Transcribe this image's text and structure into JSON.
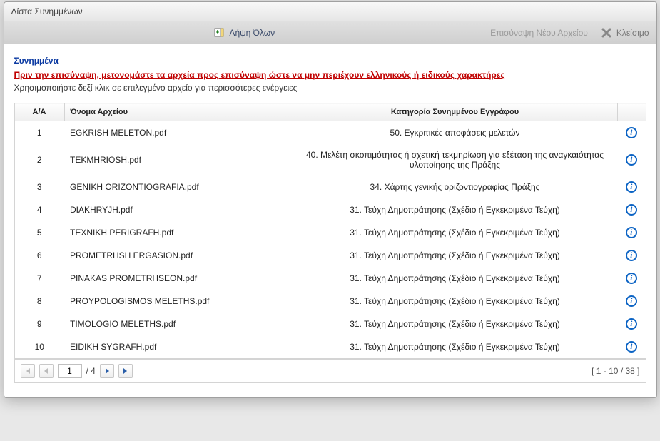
{
  "dialog": {
    "title": "Λίστα Συνημμένων"
  },
  "toolbar": {
    "download_all": "Λήψη Όλων",
    "attach_new": "Επισύναψη Νέου Αρχείου",
    "close": "Κλείσιμο"
  },
  "section": {
    "title": "Συνημμένα",
    "warning": "Πριν την επισύναψη, μετονομάστε τα αρχεία προς επισύναψη ώστε να μην περιέχουν ελληνικούς ή ειδικούς χαρακτήρες",
    "hint": "Χρησιμοποιήστε δεξί κλικ σε επιλεγμένο αρχείο για περισσότερες ενέργειες"
  },
  "columns": {
    "aa": "A/A",
    "filename": "Όνομα Αρχείου",
    "category": "Κατηγορία Συνημμένου Εγγράφου",
    "info": ""
  },
  "rows": [
    {
      "aa": "1",
      "file": "EGKRISH MELETON.pdf",
      "cat": "50. Εγκριτικές αποφάσεις μελετών"
    },
    {
      "aa": "2",
      "file": "TEKMHRIOSH.pdf",
      "cat": "40. Μελέτη σκοπιμότητας ή σχετική τεκμηρίωση για εξέταση της αναγκαιότητας υλοποίησης της Πράξης"
    },
    {
      "aa": "3",
      "file": "GENIKH ORIZONTIOGRAFIA.pdf",
      "cat": "34. Χάρτης γενικής οριζοντιογραφίας Πράξης"
    },
    {
      "aa": "4",
      "file": "DIAKHRYJH.pdf",
      "cat": "31. Τεύχη Δημοπράτησης (Σχέδιο ή Εγκεκριμένα Τεύχη)"
    },
    {
      "aa": "5",
      "file": "TEXNIKH PERIGRAFH.pdf",
      "cat": "31. Τεύχη Δημοπράτησης (Σχέδιο ή Εγκεκριμένα Τεύχη)"
    },
    {
      "aa": "6",
      "file": "PROMETRHSH ERGASION.pdf",
      "cat": "31. Τεύχη Δημοπράτησης (Σχέδιο ή Εγκεκριμένα Τεύχη)"
    },
    {
      "aa": "7",
      "file": "PINAKAS PROMETRHSEON.pdf",
      "cat": "31. Τεύχη Δημοπράτησης (Σχέδιο ή Εγκεκριμένα Τεύχη)"
    },
    {
      "aa": "8",
      "file": "PROYPOLOGISMOS MELETHS.pdf",
      "cat": "31. Τεύχη Δημοπράτησης (Σχέδιο ή Εγκεκριμένα Τεύχη)"
    },
    {
      "aa": "9",
      "file": "TIMOLOGIO MELETHS.pdf",
      "cat": "31. Τεύχη Δημοπράτησης (Σχέδιο ή Εγκεκριμένα Τεύχη)"
    },
    {
      "aa": "10",
      "file": "EIDIKH SYGRAFH.pdf",
      "cat": "31. Τεύχη Δημοπράτησης (Σχέδιο ή Εγκεκριμένα Τεύχη)"
    }
  ],
  "pager": {
    "current": "1",
    "total_label": "/ 4",
    "range": "[ 1 - 10 / 38 ]"
  }
}
